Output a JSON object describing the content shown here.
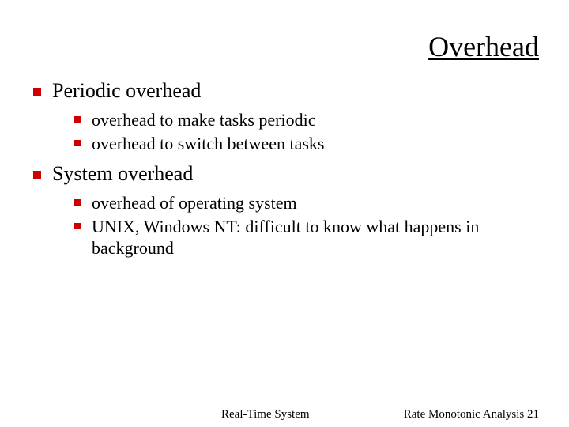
{
  "title": "Overhead",
  "bullets": {
    "l1_0": "Periodic overhead",
    "l1_0_sub": {
      "s0": "overhead to make tasks periodic",
      "s1": "overhead to switch between tasks"
    },
    "l1_1": "System overhead",
    "l1_1_sub": {
      "s0": "overhead of operating system",
      "s1": "UNIX, Windows NT: difficult to know what happens in background"
    }
  },
  "footer": {
    "left": "Real-Time System",
    "right": "Rate Monotonic Analysis 21"
  }
}
